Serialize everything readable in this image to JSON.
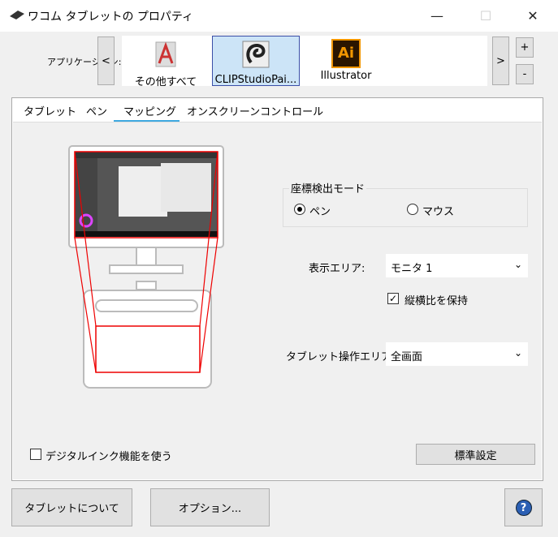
{
  "window": {
    "title": "ワコム タブレットの プロパティ",
    "minimize": "—",
    "maximize": "☐",
    "close": "✕"
  },
  "apps": {
    "label": "アプリケーション:",
    "prev": "<",
    "next": ">",
    "add": "+",
    "remove": "-",
    "items": [
      {
        "label": "その他すべて",
        "icon": "all-apps-icon"
      },
      {
        "label": "CLIPStudioPai...",
        "icon": "clip-studio-icon",
        "selected": true
      },
      {
        "label": "Illustrator",
        "icon": "illustrator-icon",
        "glyph": "Ai"
      }
    ]
  },
  "tabs": [
    {
      "label": "タブレット"
    },
    {
      "label": "ペン"
    },
    {
      "label": "マッピング",
      "active": true
    },
    {
      "label": "オンスクリーンコントロール"
    }
  ],
  "mapping": {
    "mode_group": "座標検出モード",
    "mode_pen": "ペン",
    "mode_mouse": "マウス",
    "mode_selected": "pen",
    "display_label": "表示エリア:",
    "display_value": "モニタ 1",
    "aspect_label": "縦横比を保持",
    "aspect_checked": true,
    "tablet_area_label": "タブレット操作エリア:",
    "tablet_area_value": "全画面",
    "digital_ink_label": "デジタルインク機能を使う",
    "digital_ink_checked": false,
    "default_button": "標準設定"
  },
  "footer": {
    "about": "タブレットについて",
    "options": "オプション...",
    "help": "?"
  },
  "colors": {
    "mapping_lines": "#e00000",
    "accent": "#3fa9e0",
    "selection": "#cce4f7"
  }
}
